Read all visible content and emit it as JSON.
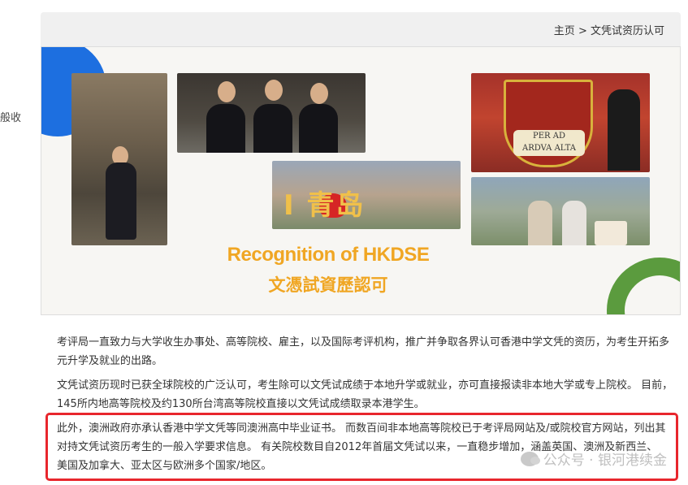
{
  "left_fragment": "般收",
  "breadcrumb": {
    "home": "主页",
    "separator": ">",
    "current": "文凭试资历认可"
  },
  "banner": {
    "title_en": "Recognition of HKDSE",
    "title_zh": "文憑試資歷認可",
    "scroll_text_line1": "PER  AD",
    "scroll_text_line2": "ARDVA ALTA",
    "sign_text": "I  青岛",
    "colors": {
      "title": "#f0a623",
      "blue_accent": "#1d6fe0",
      "green_accent": "#5b9b3e"
    }
  },
  "paragraphs": [
    "考评局一直致力与大学收生办事处、高等院校、雇主，以及国际考评机构，推广并争取各界认可香港中学文凭的资历，为考生开拓多元升学及就业的出路。",
    "文凭试资历现时已获全球院校的广泛认可，考生除可以文凭试成绩于本地升学或就业，亦可直接报读非本地大学或专上院校。 目前，145所内地高等院校及约130所台湾高等院校直接以文凭试成绩取录本港学生。",
    "此外，澳洲政府亦承认香港中学文凭等同澳洲高中毕业证书。 而数百间非本地高等院校已于考评局网站及/或院校官方网站，列出其对持文凭试资历考生的一般入学要求信息。 有关院校数目自2012年首届文凭试以来，一直稳步增加，涵盖英国、澳洲及新西兰、美国及加拿大、亚太区与欧洲多个国家/地区。"
  ],
  "highlight_color": "#e8262d",
  "watermark": {
    "text": "公众号 · 银河港续金",
    "icon": "wechat-icon"
  }
}
